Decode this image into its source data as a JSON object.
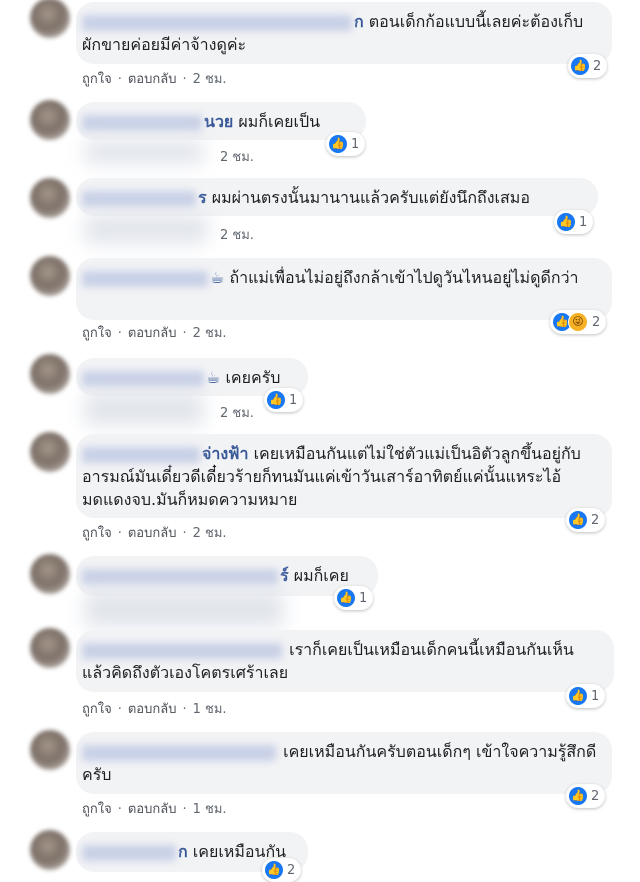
{
  "labels": {
    "like": "ถูกใจ",
    "reply": "ตอบกลับ",
    "dot": "·"
  },
  "comments": [
    {
      "name_suffix": "ก",
      "text": "ตอนเด็กก้อแบบนี้เลยค่ะต้องเก็บผักขายค่อยมีค่าจ้างดูค่ะ",
      "time": "2 ชม.",
      "reactions": "2"
    },
    {
      "name_suffix": "นวย",
      "text": "ผมก็เคยเป็น",
      "time": "2 ชม.",
      "reactions": "1"
    },
    {
      "name_suffix": "ร",
      "text": "ผมผ่านตรงนั้นมานานแล้วครับแต่ยังนึกถึงเสมอ",
      "time": "2 ชม.",
      "reactions": "1"
    },
    {
      "name_suffix": "☕",
      "text": "ถ้าแม่เพื่อนไม่อยู่ถึงกล้าเข้าไปดูวันไหนอยู่ไม่ดูดีกว่า",
      "time": "2 ชม.",
      "reactions": "2"
    },
    {
      "name_suffix": "☕",
      "text": "เคยครับ",
      "time": "2 ชม.",
      "reactions": "1"
    },
    {
      "name_suffix": "จ่างฟ้า",
      "text": "เคยเหมือนกันแต่ไม่ใช่ตัวแม่เป็นอิตัวลูกขึ้นอยู่กับอารมณ์มันเดี๋ยวดีเดี๋ยวร้ายก็ทนมันแค่เข้าวันเสาร์อาทิตย์แค่นั้นแหระไอ้มดแดงจบ.มันก็หมดความหมาย",
      "time": "2 ชม.",
      "reactions": "2"
    },
    {
      "name_suffix": "ร์",
      "text": "ผมก็เคย",
      "time": "",
      "reactions": "1"
    },
    {
      "name_suffix": "",
      "text": "เราก็เคยเป็นเหมือนเด็กคนนี้เหมือนกันเห็นแล้วคิดถึงตัวเองโคตรเศร้าเลย",
      "time": "1 ชม.",
      "reactions": "1"
    },
    {
      "name_suffix": "",
      "text": "เคยเหมือนกันครับตอนเด็กๆ เข้าใจความรู้สึกดีครับ",
      "time": "1 ชม.",
      "reactions": "2"
    },
    {
      "name_suffix": "ก",
      "text": "เคยเหมือนกัน",
      "time": "",
      "reactions": "2"
    }
  ]
}
